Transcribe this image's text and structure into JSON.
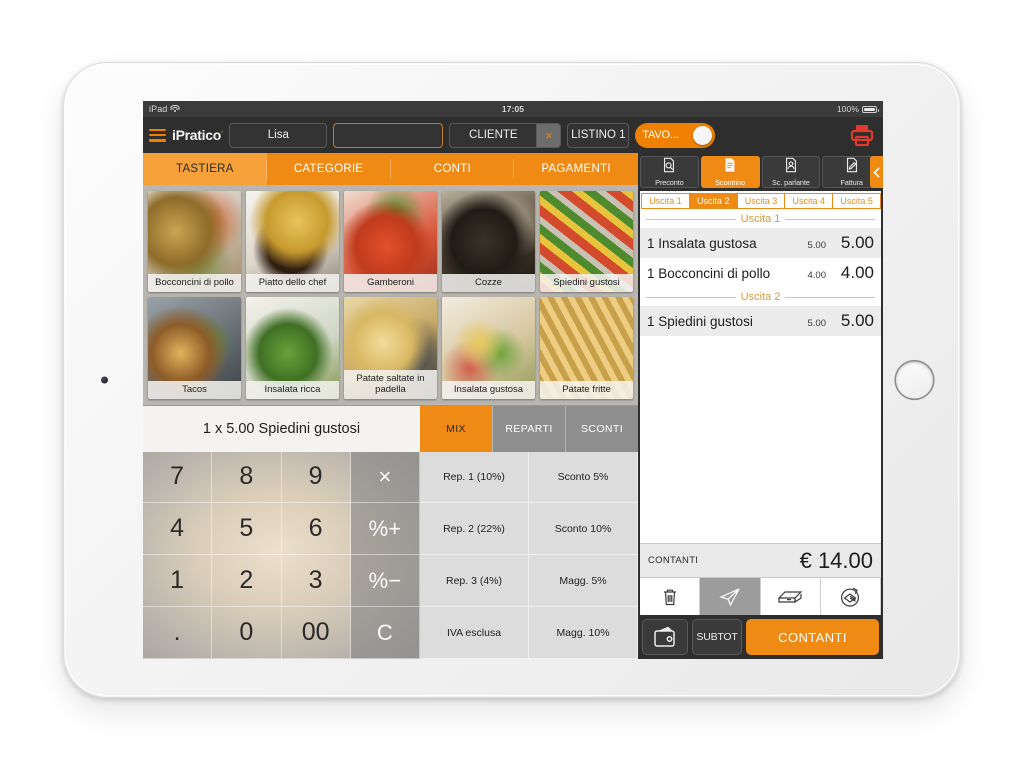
{
  "status_bar": {
    "device": "iPad",
    "wifi_icon": "wifi-icon",
    "time": "17:05",
    "battery_percent": "100%",
    "battery_icon": "battery-icon"
  },
  "app_bar": {
    "menu_icon": "hamburger-menu-icon",
    "brand": "iPratico",
    "brand_mark": "·",
    "operator_field": "Lisa",
    "empty_field": "",
    "cliente_label": "CLIENTE",
    "cliente_clear": "×",
    "listino_label": "LISTINO 1",
    "tavolo_toggle_label": "TAVO",
    "tavolo_toggle_ellipsis": "...",
    "printer_icon": "printer-icon",
    "printer_color": "#e03a2f"
  },
  "main_tabs": [
    {
      "label": "TASTIERA",
      "active": true
    },
    {
      "label": "CATEGORIE",
      "active": false
    },
    {
      "label": "CONTI",
      "active": false
    },
    {
      "label": "PAGAMENTI",
      "active": false
    }
  ],
  "products": [
    {
      "name": "Bocconcini di pollo",
      "photo": "ph-bocconcini"
    },
    {
      "name": "Piatto dello chef",
      "photo": "ph-chef"
    },
    {
      "name": "Gamberoni",
      "photo": "ph-gamberoni"
    },
    {
      "name": "Cozze",
      "photo": "ph-cozze"
    },
    {
      "name": "Spiedini gustosi",
      "photo": "ph-spiedini"
    },
    {
      "name": "Tacos",
      "photo": "ph-tacos"
    },
    {
      "name": "Insalata ricca",
      "photo": "ph-insalata-ricca"
    },
    {
      "name": "Patate saltate in padella",
      "photo": "ph-patate-saltate"
    },
    {
      "name": "Insalata gustosa",
      "photo": "ph-insalata-gustosa"
    },
    {
      "name": "Patate fritte",
      "photo": "ph-patate-fritte"
    }
  ],
  "item_display": "1 x 5.00 Spiedini gustosi",
  "mix_tabs": [
    {
      "label": "MIX",
      "active": true
    },
    {
      "label": "REPARTI",
      "active": false
    },
    {
      "label": "SCONTI",
      "active": false
    }
  ],
  "numpad": [
    {
      "label": "7",
      "type": "digit"
    },
    {
      "label": "8",
      "type": "digit"
    },
    {
      "label": "9",
      "type": "digit"
    },
    {
      "label": "×",
      "type": "op"
    },
    {
      "label": "4",
      "type": "digit"
    },
    {
      "label": "5",
      "type": "digit"
    },
    {
      "label": "6",
      "type": "digit"
    },
    {
      "label": "%+",
      "type": "op"
    },
    {
      "label": "1",
      "type": "digit"
    },
    {
      "label": "2",
      "type": "digit"
    },
    {
      "label": "3",
      "type": "digit"
    },
    {
      "label": "%−",
      "type": "op"
    },
    {
      "label": ".",
      "type": "digit"
    },
    {
      "label": "0",
      "type": "digit"
    },
    {
      "label": "00",
      "type": "digit"
    },
    {
      "label": "C",
      "type": "op"
    }
  ],
  "funcpad": [
    "Rep. 1 (10%)",
    "Sconto 5%",
    "Rep. 2 (22%)",
    "Sconto 10%",
    "Rep. 3 (4%)",
    "Magg. 5%",
    "IVA esclusa",
    "Magg. 10%"
  ],
  "doc_toolbar": [
    {
      "label": "Preconto",
      "icon": "document-search-icon",
      "active": false
    },
    {
      "label": "Scontrino",
      "icon": "receipt-icon",
      "active": true
    },
    {
      "label": "Sc. parlante",
      "icon": "person-document-icon",
      "active": false
    },
    {
      "label": "Fattura",
      "icon": "document-edit-icon",
      "active": false
    }
  ],
  "panel_handle_icon": "chevron-left-icon",
  "uscita_tabs": [
    {
      "label": "Uscita 1",
      "active": false
    },
    {
      "label": "Uscita 2",
      "active": true
    },
    {
      "label": "Uscita 3",
      "active": false
    },
    {
      "label": "Uscita 4",
      "active": false
    },
    {
      "label": "Uscita 5",
      "active": false
    }
  ],
  "receipt": {
    "courses": [
      {
        "title": "Uscita 1",
        "lines": [
          {
            "qty_name": "1 Insalata gustosa",
            "unit": "5.00",
            "total": "5.00",
            "alt": true
          },
          {
            "qty_name": "1 Bocconcini di pollo",
            "unit": "4.00",
            "total": "4.00",
            "alt": false
          }
        ]
      },
      {
        "title": "Uscita 2",
        "lines": [
          {
            "qty_name": "1 Spiedini gustosi",
            "unit": "5.00",
            "total": "5.00",
            "alt": true
          }
        ]
      }
    ],
    "total_label": "CONTANTI",
    "total_value": "€ 14.00"
  },
  "action_icons": [
    {
      "name": "trash-icon",
      "disabled": false
    },
    {
      "name": "send-icon",
      "disabled": true
    },
    {
      "name": "cash-drawer-icon",
      "disabled": false
    },
    {
      "name": "refund-icon",
      "disabled": false
    }
  ],
  "bottom_bar": {
    "wallet_icon": "wallet-icon",
    "subtot_label": "SUBTOT",
    "contanti_label": "CONTANTI"
  },
  "colors": {
    "accent_orange": "#ef8a14",
    "bar_dark": "#2e2e2e",
    "printer_red": "#e03a2f"
  }
}
